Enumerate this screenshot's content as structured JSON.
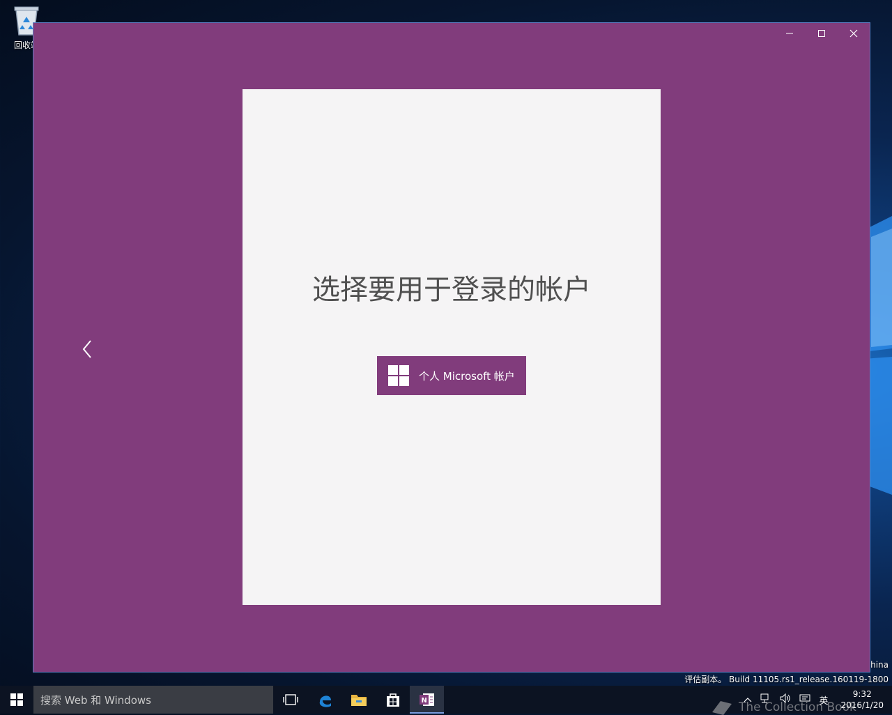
{
  "desktop": {
    "recycle_bin_label": "回收站",
    "watermark_line1": "China",
    "watermark_line2": "评估副本。 Build 11105.rs1_release.160119-1800"
  },
  "colors": {
    "app_accent": "#813c7c",
    "card_background": "#f5f4f5",
    "taskbar": "#0c1322"
  },
  "app_window": {
    "controls": [
      "minimize-icon",
      "maximize-icon",
      "close-icon"
    ],
    "back_icon": "chevron-left-icon",
    "title": "选择要用于登录的帐户",
    "account_button_label": "个人 Microsoft 帐户",
    "account_button_icon": "windows-logo-icon"
  },
  "taskbar": {
    "search_placeholder": "搜索 Web 和 Windows",
    "pinned": [
      "task-view-icon",
      "edge-icon",
      "file-explorer-icon",
      "store-icon",
      "onenote-icon"
    ],
    "active_app": "onenote-icon",
    "tray": {
      "input_language": "英",
      "time": "9:32",
      "date": "2016/1/20"
    }
  },
  "overlay_watermark": "The Collection Book"
}
